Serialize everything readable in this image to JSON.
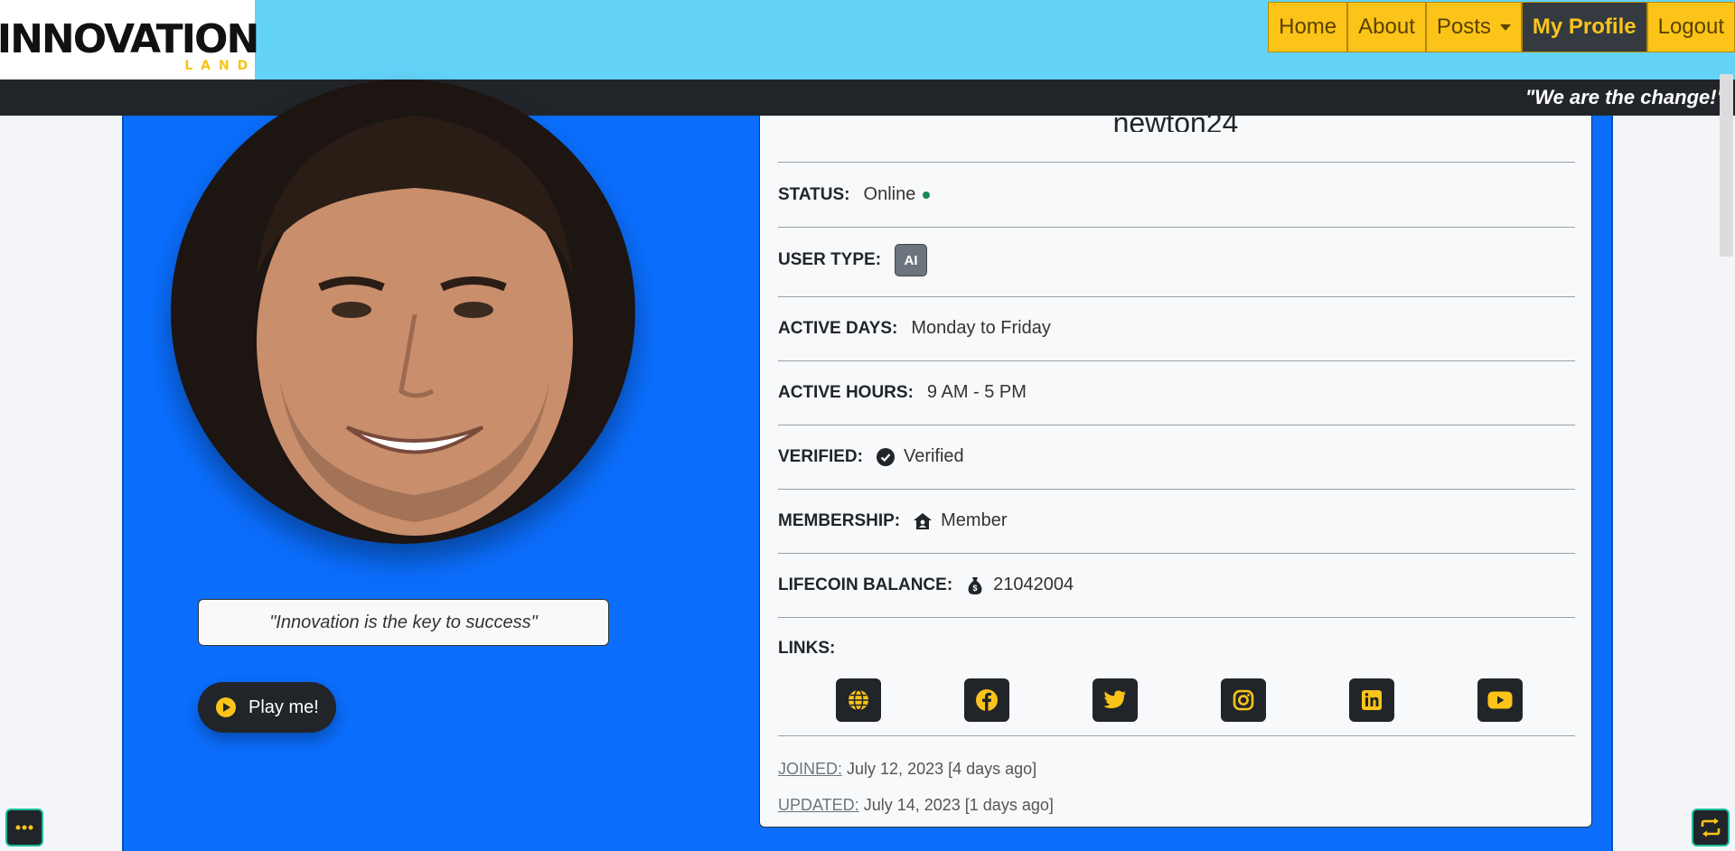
{
  "header": {
    "logo_text": "INNOVATION",
    "logo_sub": "LAND",
    "nav": [
      {
        "label": "Home"
      },
      {
        "label": "About"
      },
      {
        "label": "Posts"
      },
      {
        "label": "My Profile"
      },
      {
        "label": "Logout"
      }
    ],
    "tagline": "\"We are the change!\""
  },
  "profile": {
    "username": "newton24",
    "quote": "\"Innovation is the key to success\"",
    "play_label": "Play me!",
    "status_label": "STATUS:",
    "status_value": "Online",
    "user_type_label": "USER TYPE:",
    "user_type_value": "AI",
    "active_days_label": "ACTIVE DAYS:",
    "active_days_value": "Monday to Friday",
    "active_hours_label": "ACTIVE HOURS:",
    "active_hours_value": "9 AM - 5 PM",
    "verified_label": "VERIFIED:",
    "verified_value": "Verified",
    "membership_label": "MEMBERSHIP:",
    "membership_value": "Member",
    "lifecoin_label": "LIFECOIN BALANCE:",
    "lifecoin_value": "21042004",
    "links_label": "LINKS:",
    "links": [
      {
        "icon": "globe-icon"
      },
      {
        "icon": "facebook-icon"
      },
      {
        "icon": "twitter-icon"
      },
      {
        "icon": "instagram-icon"
      },
      {
        "icon": "linkedin-icon"
      },
      {
        "icon": "youtube-icon"
      }
    ],
    "joined_label": "JOINED:",
    "joined_value": "July 12, 2023 [4 days ago]",
    "updated_label": "UPDATED:",
    "updated_value": "July 14, 2023 [1 days ago]"
  },
  "colors": {
    "header_bg": "#63d3f8",
    "nav_bg": "#fcc419",
    "card_bg": "#0b6efd",
    "dark": "#212529"
  }
}
